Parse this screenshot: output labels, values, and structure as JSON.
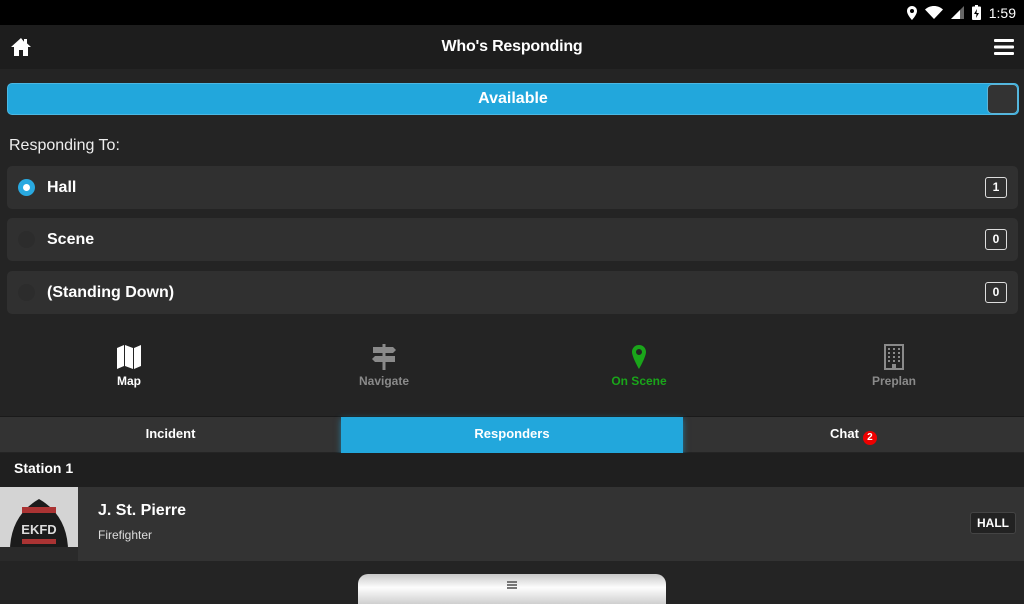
{
  "status_bar": {
    "time": "1:59",
    "icons": [
      "location-icon",
      "wifi-icon",
      "signal-icon",
      "battery-charging-icon"
    ]
  },
  "app_bar": {
    "title": "Who's Responding",
    "left_icon": "home-icon",
    "right_icon": "menu-icon"
  },
  "availability": {
    "label": "Available",
    "on": true,
    "accent": "#22a7dc"
  },
  "responding": {
    "heading": "Responding To:",
    "options": [
      {
        "label": "Hall",
        "count": "1",
        "selected": true
      },
      {
        "label": "Scene",
        "count": "0",
        "selected": false
      },
      {
        "label": "(Standing Down)",
        "count": "0",
        "selected": false
      }
    ]
  },
  "actions": [
    {
      "label": "Map",
      "icon": "map-icon",
      "color": "#ffffff"
    },
    {
      "label": "Navigate",
      "icon": "signpost-icon",
      "color": "#8a8a8a"
    },
    {
      "label": "On Scene",
      "icon": "map-pin-icon",
      "color": "#1aa51a"
    },
    {
      "label": "Preplan",
      "icon": "building-icon",
      "color": "#8a8a8a"
    }
  ],
  "tabs": [
    {
      "label": "Incident",
      "active": false
    },
    {
      "label": "Responders",
      "active": true
    },
    {
      "label": "Chat",
      "active": false,
      "badge": "2"
    }
  ],
  "responders": {
    "group": "Station 1",
    "items": [
      {
        "name": "J. St. Pierre",
        "role": "Firefighter",
        "tag": "HALL",
        "photo_text": "EKFD"
      }
    ]
  }
}
